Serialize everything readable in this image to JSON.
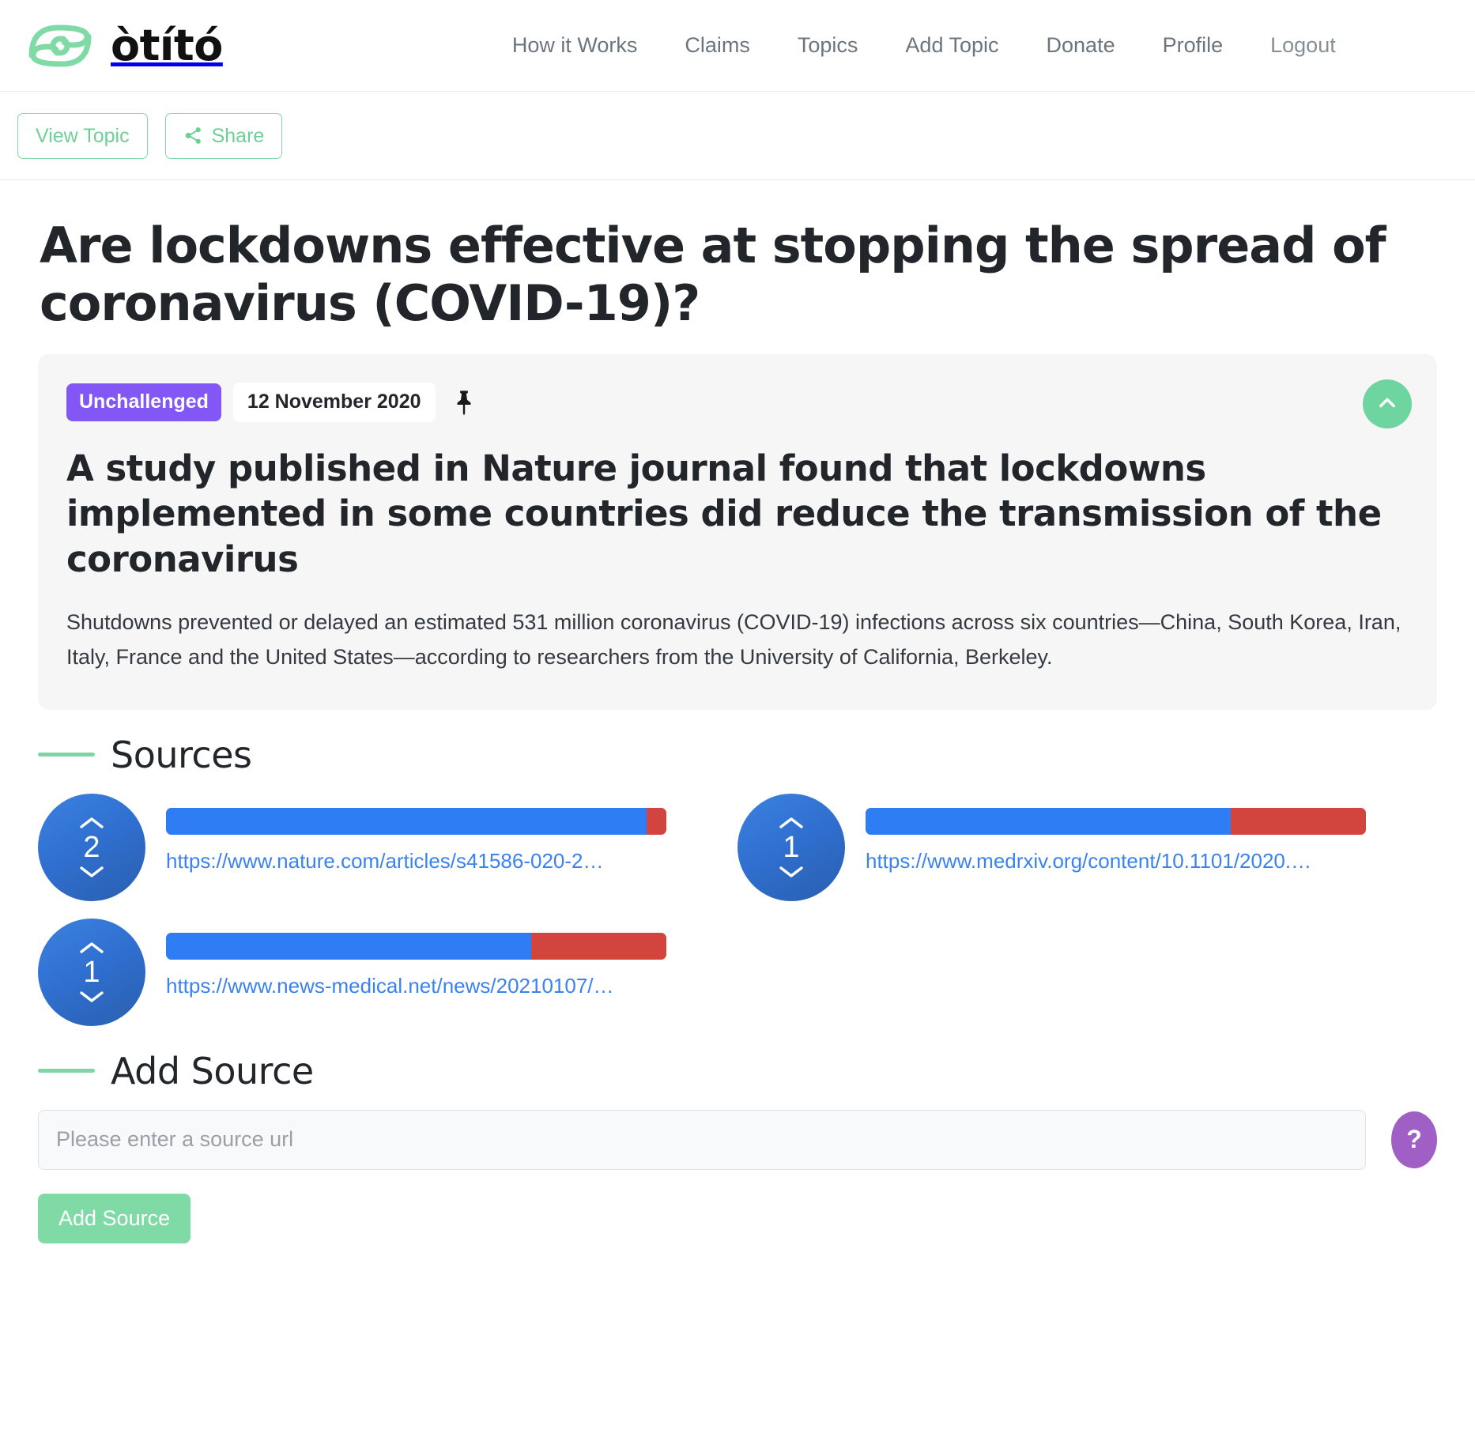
{
  "header": {
    "brand_name": "òtító",
    "logo_icon": "eye-spiral-logo",
    "nav": [
      {
        "label": "How it Works",
        "name": "nav-how-it-works"
      },
      {
        "label": "Claims",
        "name": "nav-claims"
      },
      {
        "label": "Topics",
        "name": "nav-topics"
      },
      {
        "label": "Add Topic",
        "name": "nav-add-topic"
      },
      {
        "label": "Donate",
        "name": "nav-donate"
      },
      {
        "label": "Profile",
        "name": "nav-profile"
      },
      {
        "label": "Logout",
        "name": "nav-logout"
      }
    ]
  },
  "actionbar": {
    "view_topic_label": "View Topic",
    "share_label": "Share",
    "share_icon": "share-icon"
  },
  "claim": {
    "title": "Are lockdowns effective at stopping the spread of coronavirus (COVID-19)?",
    "status_badge": "Unchallenged",
    "date": "12 November 2020",
    "pin_icon": "pin-icon",
    "collapse_icon": "chevron-up-icon",
    "headline": "A study published in Nature journal found that lockdowns implemented in some countries did reduce the transmission of the coronavirus",
    "body": "Shutdowns prevented or delayed an estimated 531 million coronavirus (COVID-19) infections across six countries—China, South Korea, Iran, Italy, France and the United States—according to researchers from the University of California, Berkeley."
  },
  "sources_section": {
    "title": "Sources",
    "items": [
      {
        "votes": "2",
        "url": "https://www.nature.com/articles/s41586-020-2…",
        "positive_pct": 96,
        "negative_pct": 4
      },
      {
        "votes": "1",
        "url": "https://www.medrxiv.org/content/10.1101/2020.…",
        "positive_pct": 73,
        "negative_pct": 27
      },
      {
        "votes": "1",
        "url": "https://www.news-medical.net/news/20210107/…",
        "positive_pct": 73,
        "negative_pct": 27
      }
    ]
  },
  "add_source_section": {
    "title": "Add Source",
    "input_placeholder": "Please enter a source url",
    "input_value": "",
    "submit_label": "Add Source",
    "help_label": "?"
  },
  "colors": {
    "green_accent": "#6ed4a0",
    "purple_badge": "#8257f5",
    "blue_vote": "#2f6fcf",
    "bar_positive": "#2f7df4",
    "bar_negative": "#d2453f",
    "link_blue": "#3b82f1",
    "help_purple": "#a05fc4"
  }
}
